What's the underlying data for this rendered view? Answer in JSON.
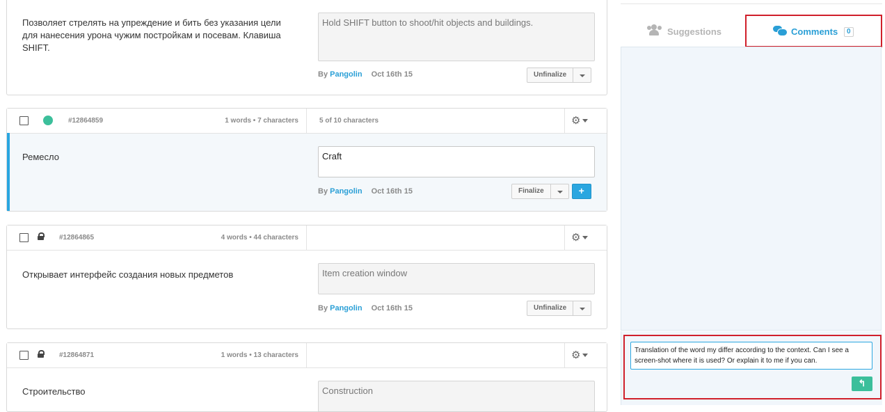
{
  "strings": [
    {
      "id": "",
      "counts": "",
      "limit": "",
      "source": "Позволяет стрелять на упреждение и бить без указания цели для нанесения урона чужим постройкам и посевам. Клавиша SHIFT.",
      "translation": "Hold SHIFT button to shoot/hit objects and buildings.",
      "author": "Pangolin",
      "date": "Oct 16th 15",
      "action": "Unfinalize"
    },
    {
      "id": "#12864859",
      "counts": "1 words • 7 characters",
      "limit": "5 of 10 characters",
      "source": "Ремесло",
      "translation": "Craft",
      "author": "Pangolin",
      "date": "Oct 16th 15",
      "action": "Finalize",
      "add": "+"
    },
    {
      "id": "#12864865",
      "counts": "4 words • 44 characters",
      "limit": "",
      "source": "Открывает интерфейс создания новых предметов",
      "translation": "Item creation window",
      "author": "Pangolin",
      "date": "Oct 16th 15",
      "action": "Unfinalize"
    },
    {
      "id": "#12864871",
      "counts": "1 words • 13 characters",
      "limit": "",
      "source": "Строительство",
      "translation": "Construction"
    }
  ],
  "by_label": "By",
  "panel": {
    "tabs": [
      {
        "label": "Suggestions",
        "icon": "users-icon",
        "active": false
      },
      {
        "label": "Comments",
        "icon": "comments-icon",
        "active": true,
        "count": "0"
      }
    ],
    "comment_text": "Translation of the word my differ according to the context. Can I see a screen-shot where it is used? Or explain it to me if you can.",
    "reply_icon": "reply-icon"
  },
  "colors": {
    "accent": "#2aa6e0",
    "link": "#2a9fd6",
    "status_green": "#3cbf9b",
    "highlight_red": "#d01f2a"
  }
}
